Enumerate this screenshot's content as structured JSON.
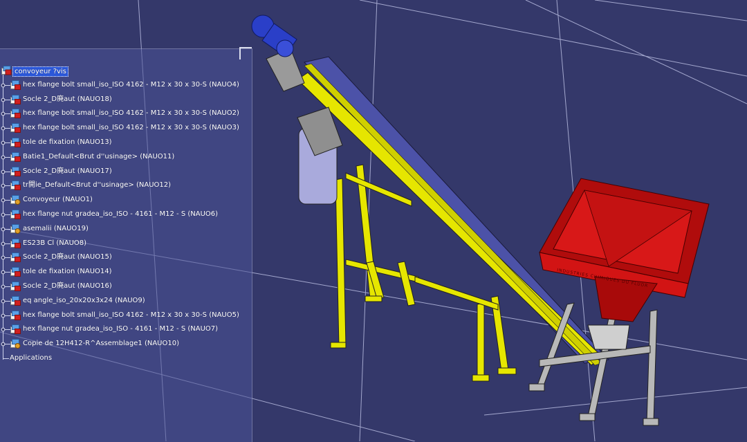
{
  "tree": {
    "root": {
      "label": "convoyeur ?vis",
      "icon": "product-icon"
    },
    "items": [
      {
        "label": "hex flange bolt small_iso_ISO 4162 - M12 x 30 x 30-S (NAUO4)",
        "icon": "part-icon"
      },
      {
        "label": "Socle 2_D廃aut (NAUO18)",
        "icon": "part-icon"
      },
      {
        "label": "hex flange bolt small_iso_ISO 4162 - M12 x 30 x 30-S (NAUO2)",
        "icon": "part-icon"
      },
      {
        "label": "hex flange bolt small_iso_ISO 4162 - M12 x 30 x 30-S (NAUO3)",
        "icon": "part-icon"
      },
      {
        "label": "tole de fixation (NAUO13)",
        "icon": "part-icon"
      },
      {
        "label": "Batie1_Default<Brut d''usinage> (NAUO11)",
        "icon": "part-icon"
      },
      {
        "label": "Socle 2_D廃aut (NAUO17)",
        "icon": "part-icon"
      },
      {
        "label": "tr開ie_Default<Brut d''usinage> (NAUO12)",
        "icon": "part-icon"
      },
      {
        "label": "Convoyeur  (NAUO1)",
        "icon": "subassembly-icon"
      },
      {
        "label": "hex flange nut gradea_iso_ISO - 4161 - M12 - S (NAUO6)",
        "icon": "part-icon"
      },
      {
        "label": "asemalii (NAUO19)",
        "icon": "subassembly-icon"
      },
      {
        "label": "ES23B Cl (NAUO8)",
        "icon": "part-icon"
      },
      {
        "label": "Socle 2_D廃aut (NAUO15)",
        "icon": "part-icon"
      },
      {
        "label": "tole de fixation (NAUO14)",
        "icon": "part-icon"
      },
      {
        "label": "Socle 2_D廃aut (NAUO16)",
        "icon": "part-icon"
      },
      {
        "label": "eq angle_iso_20x20x3x24 (NAUO9)",
        "icon": "part-icon"
      },
      {
        "label": "hex flange bolt small_iso_ISO 4162 - M12 x 30 x 30-S (NAUO5)",
        "icon": "part-icon"
      },
      {
        "label": "hex flange nut gradea_iso_ISO - 4161 - M12 - S (NAUO7)",
        "icon": "part-icon"
      },
      {
        "label": "Copie de 12H412-R^Assemblage1 (NAUO10)",
        "icon": "subassembly-icon"
      }
    ],
    "applications": {
      "label": "Applications"
    }
  },
  "model": {
    "hopper_text": "INDUSTRIES CHIMIQUES DU FLUOR"
  },
  "colors": {
    "background": "#34386a",
    "conveyor_frame": "#e6e600",
    "hopper": "#cc1010",
    "motor": "#2a3fc8",
    "support": "#b8b8b8",
    "selection": "#2b57d8"
  }
}
